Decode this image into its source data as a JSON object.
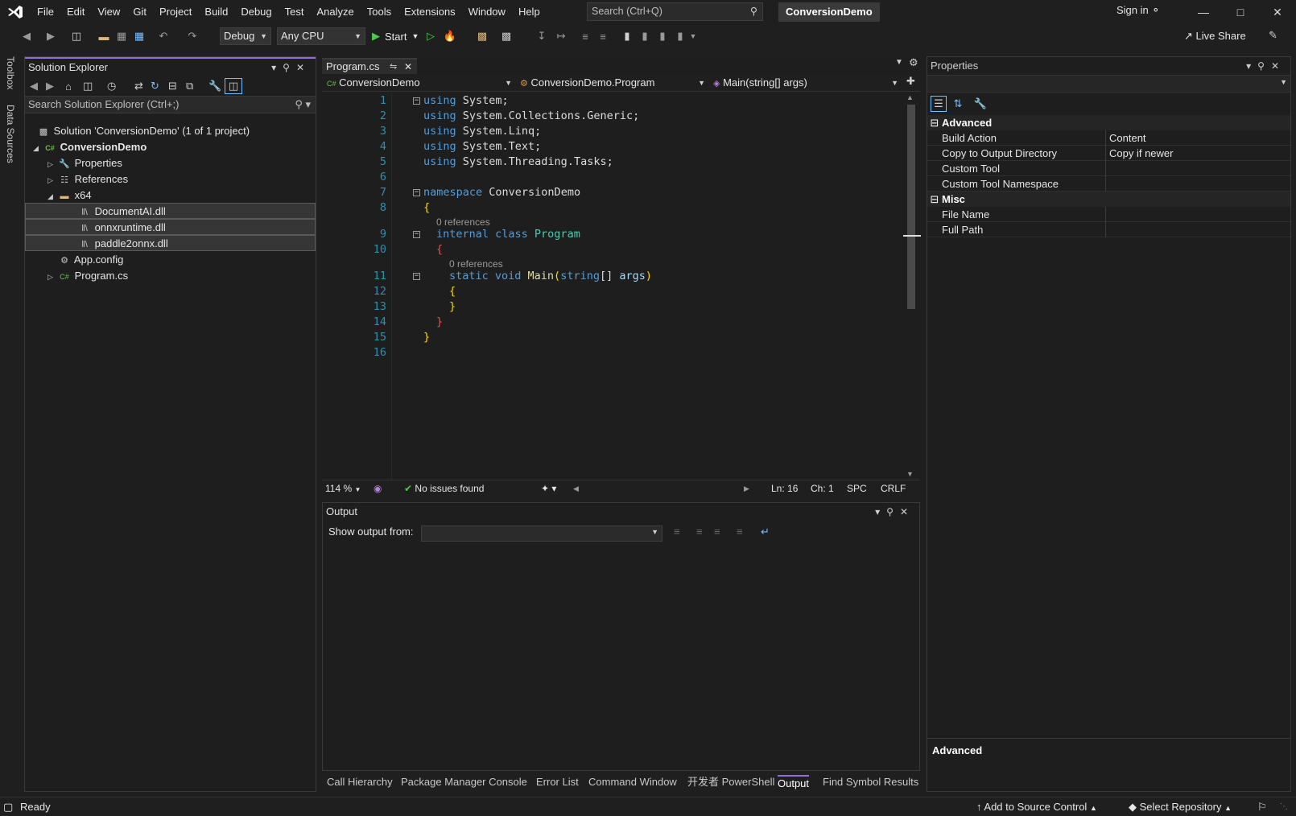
{
  "menu": [
    "File",
    "Edit",
    "View",
    "Git",
    "Project",
    "Build",
    "Debug",
    "Test",
    "Analyze",
    "Tools",
    "Extensions",
    "Window",
    "Help"
  ],
  "search": {
    "placeholder": "Search (Ctrl+Q)"
  },
  "app_title": "ConversionDemo",
  "signin": "Sign in",
  "toolbar": {
    "config": "Debug",
    "platform": "Any CPU",
    "start": "Start",
    "live_share": "Live Share"
  },
  "side_strip": [
    "Toolbox",
    "Data Sources"
  ],
  "solution_explorer": {
    "title": "Solution Explorer",
    "search_placeholder": "Search Solution Explorer (Ctrl+;)",
    "items": [
      {
        "label": "Solution 'ConversionDemo' (1 of 1 project)",
        "icon": "solution-icon"
      },
      {
        "label": "ConversionDemo",
        "icon": "csharp-project-icon"
      },
      {
        "label": "Properties",
        "icon": "wrench-icon"
      },
      {
        "label": "References",
        "icon": "references-icon"
      },
      {
        "label": "x64",
        "icon": "folder-icon"
      },
      {
        "label": "DocumentAI.dll",
        "icon": "library-icon"
      },
      {
        "label": "onnxruntime.dll",
        "icon": "library-icon"
      },
      {
        "label": "paddle2onnx.dll",
        "icon": "library-icon"
      },
      {
        "label": "App.config",
        "icon": "config-file-icon"
      },
      {
        "label": "Program.cs",
        "icon": "csharp-file-icon"
      }
    ]
  },
  "editor": {
    "tab": "Program.cs",
    "nav": {
      "project": "ConversionDemo",
      "class": "ConversionDemo.Program",
      "member": "Main(string[] args)"
    },
    "line_numbers": [
      "1",
      "2",
      "3",
      "4",
      "5",
      "6",
      "7",
      "8",
      "9",
      "10",
      "11",
      "12",
      "13",
      "14",
      "15",
      "16"
    ],
    "code": {
      "l1_kw": "using",
      "l1_rest": " System;",
      "l2_kw": "using",
      "l2_rest": " System.Collections.Generic;",
      "l3_kw": "using",
      "l3_rest": " System.Linq;",
      "l4_kw": "using",
      "l4_rest": " System.Text;",
      "l5_kw": "using",
      "l5_rest": " System.Threading.Tasks;",
      "l7_kw": "namespace",
      "l7_rest": " ConversionDemo",
      "l8": "{",
      "ref1": "0 references",
      "l9_kw": "internal class",
      "l9_ty": " Program",
      "l10": "{",
      "ref2": "0 references",
      "l11_kw": "static void",
      "l11_fn": " Main",
      "l11_open": "(",
      "l11_ty": "string",
      "l11_arr": "[] ",
      "l11_par": "args",
      "l11_close": ")",
      "l12": "{",
      "l13": "}",
      "l14": "}",
      "l15": "}"
    },
    "status": {
      "zoom": "114 %",
      "issues": "No issues found",
      "ln": "Ln: 16",
      "ch": "Ch: 1",
      "spc": "SPC",
      "crlf": "CRLF"
    }
  },
  "output": {
    "title": "Output",
    "show_from_label": "Show output from:"
  },
  "bottom_tabs": [
    "Call Hierarchy",
    "Package Manager Console",
    "Error List",
    "Command Window",
    "开发者 PowerShell",
    "Output",
    "Find Symbol Results"
  ],
  "properties": {
    "title": "Properties",
    "categories": [
      {
        "name": "Advanced",
        "rows": [
          {
            "key": "Build Action",
            "value": "Content"
          },
          {
            "key": "Copy to Output Directory",
            "value": "Copy if newer"
          },
          {
            "key": "Custom Tool",
            "value": ""
          },
          {
            "key": "Custom Tool Namespace",
            "value": ""
          }
        ]
      },
      {
        "name": "Misc",
        "rows": [
          {
            "key": "File Name",
            "value": ""
          },
          {
            "key": "Full Path",
            "value": ""
          }
        ]
      }
    ],
    "description_title": "Advanced"
  },
  "statusbar": {
    "ready": "Ready",
    "source_control": "Add to Source Control",
    "select_repo": "Select Repository"
  },
  "colors": {
    "accent": "#8f6ed5",
    "keyword": "#569cd6",
    "type": "#4ec9b0",
    "method": "#dcdcaa",
    "line_number": "#2b91af"
  }
}
